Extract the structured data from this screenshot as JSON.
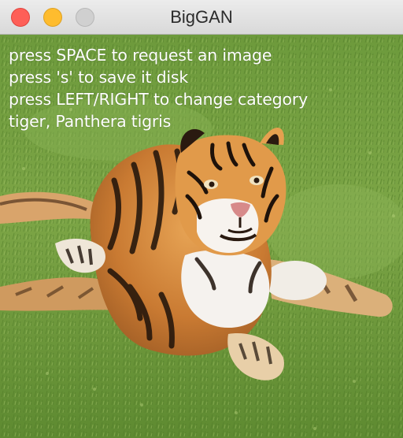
{
  "window": {
    "title": "BigGAN",
    "controls": {
      "close_color": "#fe5f57",
      "minimize_color": "#febc2e",
      "maximize_color": "#d0d0d0"
    }
  },
  "overlay": {
    "lines": [
      "press SPACE to request an image",
      "press 's' to save it disk",
      "press LEFT/RIGHT to change category",
      "tiger, Panthera tigris"
    ]
  },
  "image": {
    "subject": "generated image of a tiger lying on grass",
    "category": "tiger, Panthera tigris"
  }
}
